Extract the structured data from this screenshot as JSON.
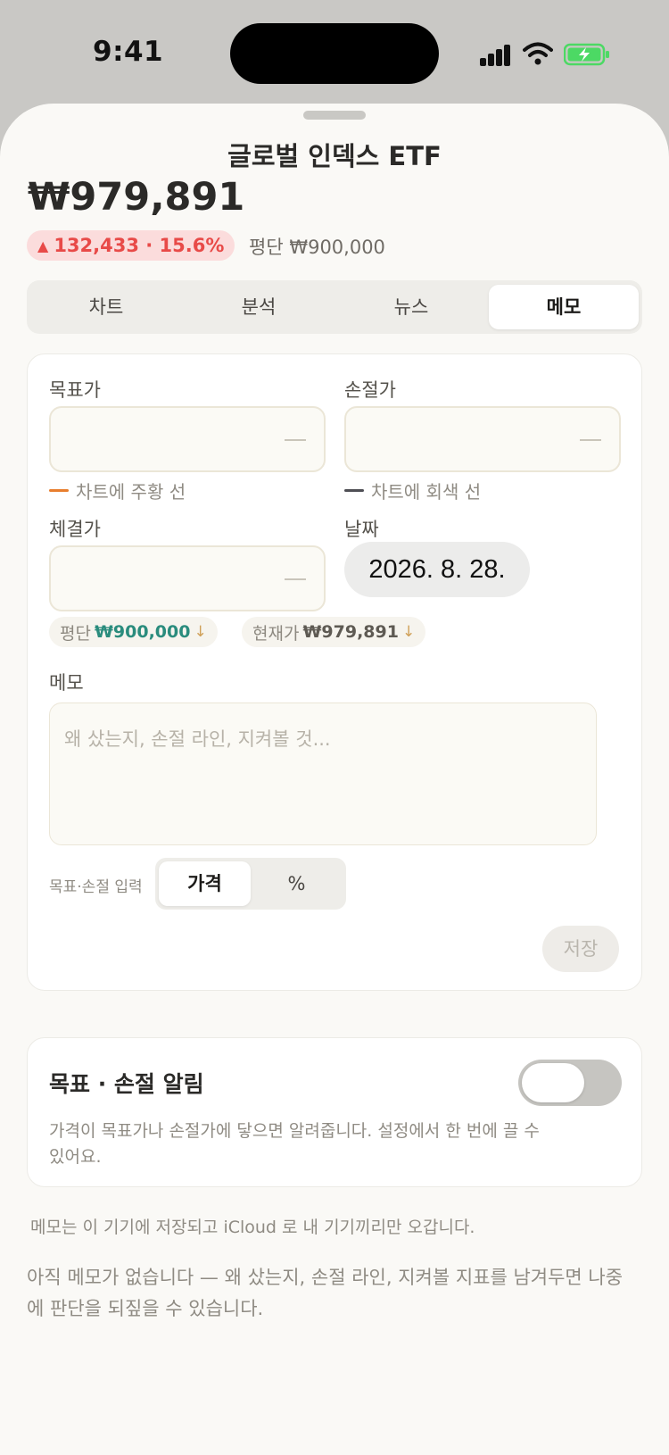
{
  "status": {
    "time": "9:41"
  },
  "sheet": {
    "title": "글로벌 인덱스 ETF",
    "price": "₩979,891",
    "change": {
      "arrow": "▲",
      "text": "132,433 · 15.6%"
    },
    "avg": "평단 ₩900,000"
  },
  "tabs": [
    {
      "label": "차트"
    },
    {
      "label": "분석"
    },
    {
      "label": "뉴스"
    },
    {
      "label": "메모"
    }
  ],
  "memo": {
    "target_label": "목표가",
    "target_value": "—",
    "target_hint": "차트에 주황 선",
    "stop_label": "손절가",
    "stop_value": "—",
    "stop_hint": "차트에 회색 선",
    "fill_label": "체결가",
    "fill_value": "—",
    "date_label": "날짜",
    "date_value": "2026. 8. 28.",
    "chip_avg_prefix": "평단",
    "chip_avg_value": "₩900,000",
    "chip_cur_prefix": "현재가",
    "chip_cur_value": "₩979,891",
    "chip_arrow": "↓",
    "memo_label": "메모",
    "memo_placeholder": "왜 샀는지, 손절 라인, 지켜볼 것...",
    "mode_label": "목표·손절 입력",
    "mode_options": [
      "가격",
      "%"
    ],
    "save_label": "저장"
  },
  "alert": {
    "title": "목표 · 손절 알림",
    "desc": "가격이 목표가나 손절가에 닿으면 알려줍니다. 설정에서 한 번에 끌 수 있어요."
  },
  "footnote": "메모는 이 기기에 저장되고 iCloud 로 내 기기끼리만 오갑니다.",
  "empty_note": "아직 메모가 없습니다 — 왜 샀는지, 손절 라인, 지켜볼 지표를 남겨두면 나중에 판단을 되짚을 수 있습니다.",
  "colors": {
    "accent_orange": "#e87e2e",
    "accent_gray": "#4f4f55",
    "up_red": "#e84a48",
    "avg_green": "#2a8c7d"
  }
}
